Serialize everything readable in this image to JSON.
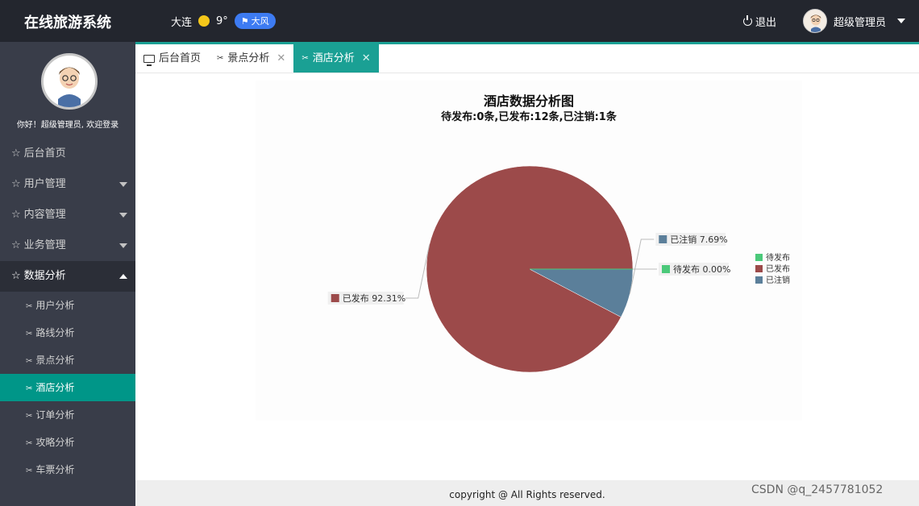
{
  "header": {
    "brand": "在线旅游系统",
    "city": "大连",
    "temperature": "9°",
    "wind": "大风",
    "logout_label": "退出",
    "user_name": "超级管理员"
  },
  "sidebar": {
    "welcome": "你好！超级管理员, 欢迎登录",
    "items": [
      {
        "label": "后台首页"
      },
      {
        "label": "用户管理"
      },
      {
        "label": "内容管理"
      },
      {
        "label": "业务管理"
      },
      {
        "label": "数据分析"
      }
    ],
    "sub_items": [
      {
        "label": "用户分析"
      },
      {
        "label": "路线分析"
      },
      {
        "label": "景点分析"
      },
      {
        "label": "酒店分析"
      },
      {
        "label": "订单分析"
      },
      {
        "label": "攻略分析"
      },
      {
        "label": "车票分析"
      }
    ]
  },
  "tabs": [
    {
      "label": "后台首页"
    },
    {
      "label": "景点分析"
    },
    {
      "label": "酒店分析"
    }
  ],
  "chart_data": {
    "type": "pie",
    "title": "酒店数据分析图",
    "subtitle": "待发布:0条,已发布:12条,已注销:1条",
    "categories": [
      "待发布",
      "已发布",
      "已注销"
    ],
    "values": [
      0,
      12,
      1
    ],
    "percent_labels": [
      "待发布 0.00%",
      "已发布 92.31%",
      "已注销 7.69%"
    ],
    "colors": [
      "#4bc97a",
      "#9c4a4a",
      "#5b7f9a"
    ],
    "legend_position": "right"
  },
  "footer": {
    "copyright": "copyright @ All Rights reserved."
  },
  "watermark": "CSDN @q_2457781052"
}
